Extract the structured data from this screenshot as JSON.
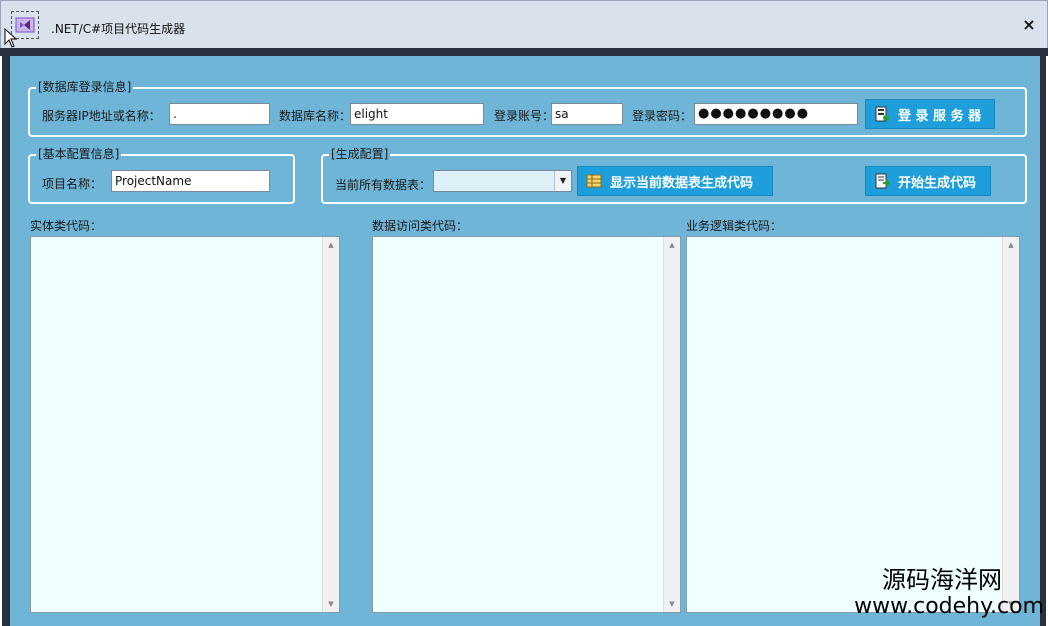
{
  "window": {
    "title": ".NET/C#项目代码生成器",
    "close_glyph": "×"
  },
  "db_login": {
    "legend": "[数据库登录信息]",
    "server_label": "服务器IP地址或名称：",
    "server_value": ".",
    "dbname_label": "数据库名称：",
    "dbname_value": "elight",
    "account_label": "登录账号：",
    "account_value": "sa",
    "password_label": "登录密码：",
    "password_value": "●●●●●●●●●",
    "login_button": "登 录 服 务 器"
  },
  "basic_config": {
    "legend": "[基本配置信息]",
    "project_label": "项目名称：",
    "project_value": "ProjectName"
  },
  "gen_config": {
    "legend": "[生成配置]",
    "tables_label": "当前所有数据表：",
    "tables_selected": "",
    "show_button": "显示当前数据表生成代码",
    "start_button": "开始生成代码"
  },
  "code_panels": [
    {
      "label": "实体类代码："
    },
    {
      "label": "数据访问类代码："
    },
    {
      "label": "业务逻辑类代码："
    }
  ],
  "watermark": {
    "line1": "源码海洋网",
    "line2": "www.codehy.com"
  },
  "colors": {
    "client_bg": "#6fb5d7",
    "button_bg": "#1e9fdc",
    "codebox_bg": "#f0ffff"
  }
}
